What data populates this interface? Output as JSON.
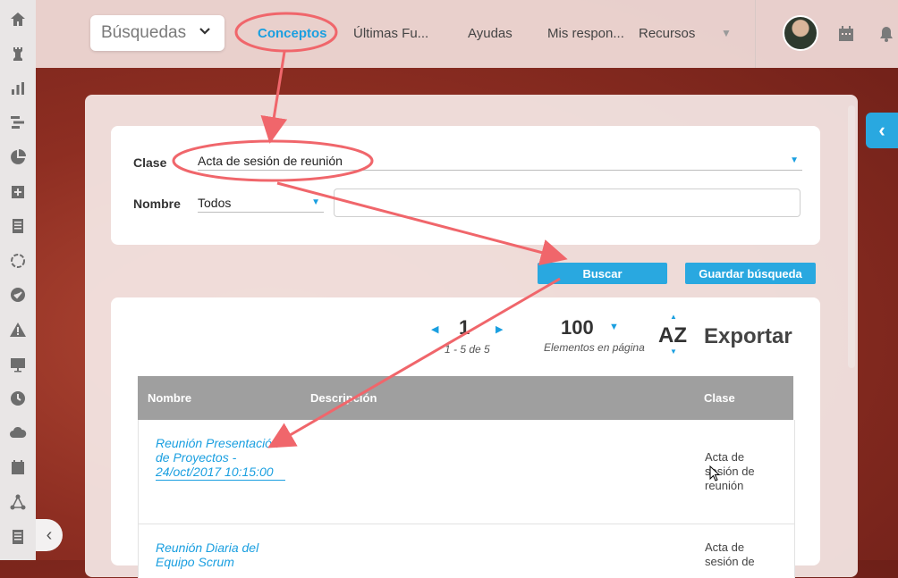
{
  "sidebar": {
    "icons": [
      "home-icon",
      "chess-rook-icon",
      "bar-chart-icon",
      "gantt-icon",
      "pie-chart-icon",
      "plus-square-icon",
      "document-icon",
      "cycle-icon",
      "check-circle-icon",
      "warning-icon",
      "presentation-icon",
      "clock-icon",
      "cloud-icon",
      "calendar-icon",
      "network-icon",
      "list-icon"
    ]
  },
  "topbar": {
    "search_select": "Búsquedas",
    "nav": [
      "Conceptos",
      "Últimas Fu...",
      "Ayudas",
      "Mis respon...",
      "Recursos"
    ]
  },
  "form": {
    "clase_label": "Clase",
    "clase_value": "Acta de sesión de reunión",
    "nombre_label": "Nombre",
    "nombre_value": "Todos",
    "nombre_input": ""
  },
  "buttons": {
    "buscar": "Buscar",
    "guardar": "Guardar búsqueda"
  },
  "results": {
    "page": "1",
    "page_info": "1 - 5 de 5",
    "per_page": "100",
    "per_page_label": "Elementos en página",
    "sort": "AZ",
    "export": "Exportar",
    "columns": [
      "Nombre",
      "Descripción",
      "Clase"
    ],
    "rows": [
      {
        "nombre": "Reunión Presentación de Proyectos - 24/oct/2017 10:15:00",
        "descripcion": "",
        "clase": "Acta de sesión de reunión"
      },
      {
        "nombre": "Reunión Diaria del Equipo Scrum",
        "descripcion": "",
        "clase": "Acta de sesión de"
      }
    ]
  },
  "colors": {
    "accent": "#29a8e0",
    "annotation": "#f0666b"
  }
}
